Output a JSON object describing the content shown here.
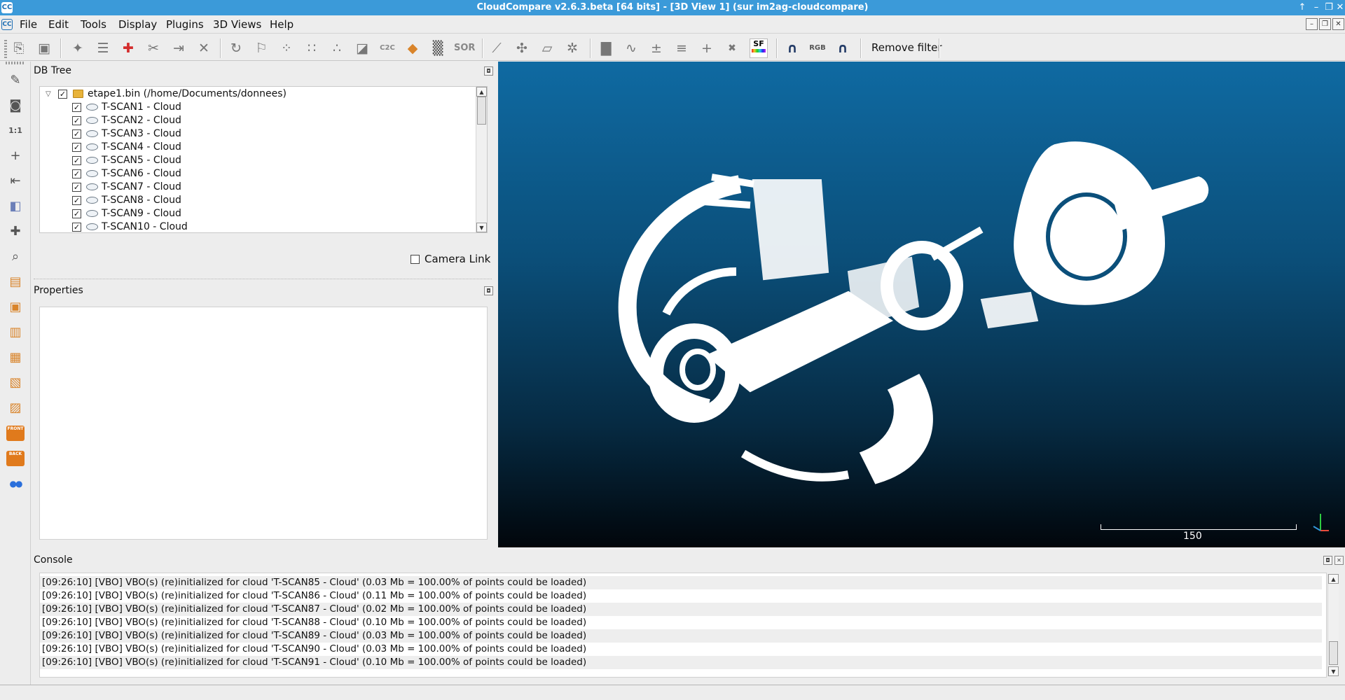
{
  "window": {
    "title": "CloudCompare v2.6.3.beta [64 bits] - [3D View 1] (sur im2ag-cloudcompare)",
    "app_icon": "CC",
    "controls": [
      "↑",
      "–",
      "❐",
      "✕"
    ]
  },
  "menubar": {
    "app_icon": "CC",
    "items": [
      "File",
      "Edit",
      "Tools",
      "Display",
      "Plugins",
      "3D Views",
      "Help"
    ],
    "mdi_controls": [
      "–",
      "❐",
      "✕"
    ]
  },
  "toolbar": {
    "buttons": [
      {
        "name": "open-icon",
        "glyph": "⎘"
      },
      {
        "name": "save-icon",
        "glyph": "▣"
      },
      {
        "name": "clone-icon",
        "glyph": "✦"
      },
      {
        "name": "merge-icon",
        "glyph": "☰"
      },
      {
        "name": "translate-rotate-icon",
        "glyph": "✚",
        "red": true
      },
      {
        "name": "segment-icon",
        "glyph": "✂"
      },
      {
        "name": "sample-icon",
        "glyph": "⇥"
      },
      {
        "name": "delete-icon",
        "glyph": "✕"
      },
      {
        "name": "align-icon",
        "glyph": "↻"
      },
      {
        "name": "register-icon",
        "glyph": "⚐"
      },
      {
        "name": "subsample-icon",
        "glyph": "⁘"
      },
      {
        "name": "density-icon",
        "glyph": "∷"
      },
      {
        "name": "noise-icon",
        "glyph": "∴"
      },
      {
        "name": "mesh-icon",
        "glyph": "◪"
      },
      {
        "name": "cc-distance-icon",
        "glyph": "C2C"
      },
      {
        "name": "primitive-icon",
        "glyph": "◆"
      },
      {
        "name": "checker-icon",
        "glyph": "▒"
      },
      {
        "name": "sor-filter-icon",
        "glyph": "SOR"
      },
      {
        "name": "normals-icon",
        "glyph": "⟋"
      },
      {
        "name": "pick-point-icon",
        "glyph": "✣"
      },
      {
        "name": "plane-icon",
        "glyph": "▱"
      },
      {
        "name": "compass-icon",
        "glyph": "✲"
      },
      {
        "name": "histogram-icon",
        "glyph": "▇"
      },
      {
        "name": "statistics-icon",
        "glyph": "∿"
      },
      {
        "name": "sf-arith-icon",
        "glyph": "±"
      },
      {
        "name": "sf-filter-icon",
        "glyph": "≡"
      },
      {
        "name": "add-sf-icon",
        "glyph": "+"
      },
      {
        "name": "delete-sf-icon",
        "glyph": "✖"
      },
      {
        "name": "scalar-field-icon",
        "glyph": "SF"
      },
      {
        "name": "mesh-filter-1-icon",
        "glyph": "∩"
      },
      {
        "name": "rgb-filter-icon",
        "glyph": "RGB"
      },
      {
        "name": "mesh-filter-2-icon",
        "glyph": "∩"
      }
    ],
    "remove_filter_label": "Remove filter"
  },
  "left_toolbar": [
    {
      "name": "pencil-icon",
      "glyph": "✎"
    },
    {
      "name": "camera-icon",
      "glyph": "◙"
    },
    {
      "name": "zoom-1to1-icon",
      "glyph": "1:1"
    },
    {
      "name": "center-icon",
      "glyph": "+"
    },
    {
      "name": "pivot-icon",
      "glyph": "⇤"
    },
    {
      "name": "view-mode-icon",
      "glyph": "◧"
    },
    {
      "name": "rotation-center-icon",
      "glyph": "✚"
    },
    {
      "name": "zoom-icon",
      "glyph": "⌕"
    },
    {
      "name": "view-top-icon",
      "glyph": "▤"
    },
    {
      "name": "view-front-icon",
      "glyph": "▣"
    },
    {
      "name": "view-left-icon",
      "glyph": "▥"
    },
    {
      "name": "view-back-icon",
      "glyph": "▦"
    },
    {
      "name": "view-right-icon",
      "glyph": "▧"
    },
    {
      "name": "view-bottom-icon",
      "glyph": "▨"
    },
    {
      "name": "iso-front-icon",
      "glyph": "FRONT"
    },
    {
      "name": "iso-back-icon",
      "glyph": "BACK"
    },
    {
      "name": "stereo-icon",
      "glyph": "●●"
    }
  ],
  "dbtree": {
    "title": "DB Tree",
    "root": {
      "label": "etape1.bin (/home/Documents/donnees)",
      "checked": true,
      "expanded": true
    },
    "items": [
      {
        "label": "T-SCAN1 - Cloud",
        "checked": true
      },
      {
        "label": "T-SCAN2 - Cloud",
        "checked": true
      },
      {
        "label": "T-SCAN3 - Cloud",
        "checked": true
      },
      {
        "label": "T-SCAN4 - Cloud",
        "checked": true
      },
      {
        "label": "T-SCAN5 - Cloud",
        "checked": true
      },
      {
        "label": "T-SCAN6 - Cloud",
        "checked": true
      },
      {
        "label": "T-SCAN7 - Cloud",
        "checked": true
      },
      {
        "label": "T-SCAN8 - Cloud",
        "checked": true
      },
      {
        "label": "T-SCAN9 - Cloud",
        "checked": true
      },
      {
        "label": "T-SCAN10 - Cloud",
        "checked": true
      }
    ],
    "camera_link_label": "Camera Link",
    "camera_link_checked": false
  },
  "properties": {
    "title": "Properties"
  },
  "view3d": {
    "scale_label": "150",
    "colors": {
      "top": "#0f6aa2",
      "bottom": "#01060b",
      "cloud": "#ffffff"
    }
  },
  "console": {
    "title": "Console",
    "lines": [
      "[09:26:10] [VBO] VBO(s) (re)initialized for cloud 'T-SCAN85 - Cloud' (0.03 Mb = 100.00% of points could be loaded)",
      "[09:26:10] [VBO] VBO(s) (re)initialized for cloud 'T-SCAN86 - Cloud' (0.11 Mb = 100.00% of points could be loaded)",
      "[09:26:10] [VBO] VBO(s) (re)initialized for cloud 'T-SCAN87 - Cloud' (0.02 Mb = 100.00% of points could be loaded)",
      "[09:26:10] [VBO] VBO(s) (re)initialized for cloud 'T-SCAN88 - Cloud' (0.10 Mb = 100.00% of points could be loaded)",
      "[09:26:10] [VBO] VBO(s) (re)initialized for cloud 'T-SCAN89 - Cloud' (0.03 Mb = 100.00% of points could be loaded)",
      "[09:26:10] [VBO] VBO(s) (re)initialized for cloud 'T-SCAN90 - Cloud' (0.03 Mb = 100.00% of points could be loaded)",
      "[09:26:10] [VBO] VBO(s) (re)initialized for cloud 'T-SCAN91 - Cloud' (0.10 Mb = 100.00% of points could be loaded)"
    ]
  }
}
